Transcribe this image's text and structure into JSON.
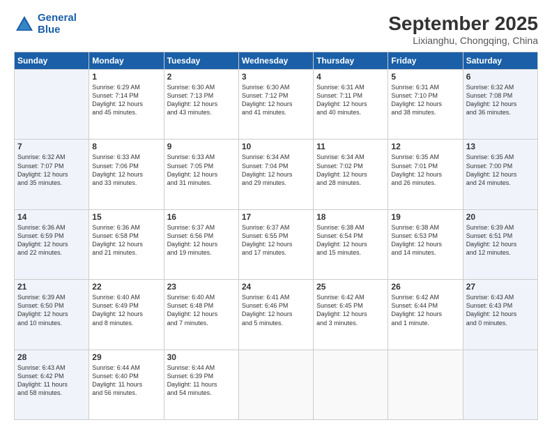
{
  "header": {
    "logo_line1": "General",
    "logo_line2": "Blue",
    "month": "September 2025",
    "location": "Lixianghu, Chongqing, China"
  },
  "weekdays": [
    "Sunday",
    "Monday",
    "Tuesday",
    "Wednesday",
    "Thursday",
    "Friday",
    "Saturday"
  ],
  "weeks": [
    [
      {
        "day": "",
        "info": ""
      },
      {
        "day": "1",
        "info": "Sunrise: 6:29 AM\nSunset: 7:14 PM\nDaylight: 12 hours\nand 45 minutes."
      },
      {
        "day": "2",
        "info": "Sunrise: 6:30 AM\nSunset: 7:13 PM\nDaylight: 12 hours\nand 43 minutes."
      },
      {
        "day": "3",
        "info": "Sunrise: 6:30 AM\nSunset: 7:12 PM\nDaylight: 12 hours\nand 41 minutes."
      },
      {
        "day": "4",
        "info": "Sunrise: 6:31 AM\nSunset: 7:11 PM\nDaylight: 12 hours\nand 40 minutes."
      },
      {
        "day": "5",
        "info": "Sunrise: 6:31 AM\nSunset: 7:10 PM\nDaylight: 12 hours\nand 38 minutes."
      },
      {
        "day": "6",
        "info": "Sunrise: 6:32 AM\nSunset: 7:08 PM\nDaylight: 12 hours\nand 36 minutes."
      }
    ],
    [
      {
        "day": "7",
        "info": "Sunrise: 6:32 AM\nSunset: 7:07 PM\nDaylight: 12 hours\nand 35 minutes."
      },
      {
        "day": "8",
        "info": "Sunrise: 6:33 AM\nSunset: 7:06 PM\nDaylight: 12 hours\nand 33 minutes."
      },
      {
        "day": "9",
        "info": "Sunrise: 6:33 AM\nSunset: 7:05 PM\nDaylight: 12 hours\nand 31 minutes."
      },
      {
        "day": "10",
        "info": "Sunrise: 6:34 AM\nSunset: 7:04 PM\nDaylight: 12 hours\nand 29 minutes."
      },
      {
        "day": "11",
        "info": "Sunrise: 6:34 AM\nSunset: 7:02 PM\nDaylight: 12 hours\nand 28 minutes."
      },
      {
        "day": "12",
        "info": "Sunrise: 6:35 AM\nSunset: 7:01 PM\nDaylight: 12 hours\nand 26 minutes."
      },
      {
        "day": "13",
        "info": "Sunrise: 6:35 AM\nSunset: 7:00 PM\nDaylight: 12 hours\nand 24 minutes."
      }
    ],
    [
      {
        "day": "14",
        "info": "Sunrise: 6:36 AM\nSunset: 6:59 PM\nDaylight: 12 hours\nand 22 minutes."
      },
      {
        "day": "15",
        "info": "Sunrise: 6:36 AM\nSunset: 6:58 PM\nDaylight: 12 hours\nand 21 minutes."
      },
      {
        "day": "16",
        "info": "Sunrise: 6:37 AM\nSunset: 6:56 PM\nDaylight: 12 hours\nand 19 minutes."
      },
      {
        "day": "17",
        "info": "Sunrise: 6:37 AM\nSunset: 6:55 PM\nDaylight: 12 hours\nand 17 minutes."
      },
      {
        "day": "18",
        "info": "Sunrise: 6:38 AM\nSunset: 6:54 PM\nDaylight: 12 hours\nand 15 minutes."
      },
      {
        "day": "19",
        "info": "Sunrise: 6:38 AM\nSunset: 6:53 PM\nDaylight: 12 hours\nand 14 minutes."
      },
      {
        "day": "20",
        "info": "Sunrise: 6:39 AM\nSunset: 6:51 PM\nDaylight: 12 hours\nand 12 minutes."
      }
    ],
    [
      {
        "day": "21",
        "info": "Sunrise: 6:39 AM\nSunset: 6:50 PM\nDaylight: 12 hours\nand 10 minutes."
      },
      {
        "day": "22",
        "info": "Sunrise: 6:40 AM\nSunset: 6:49 PM\nDaylight: 12 hours\nand 8 minutes."
      },
      {
        "day": "23",
        "info": "Sunrise: 6:40 AM\nSunset: 6:48 PM\nDaylight: 12 hours\nand 7 minutes."
      },
      {
        "day": "24",
        "info": "Sunrise: 6:41 AM\nSunset: 6:46 PM\nDaylight: 12 hours\nand 5 minutes."
      },
      {
        "day": "25",
        "info": "Sunrise: 6:42 AM\nSunset: 6:45 PM\nDaylight: 12 hours\nand 3 minutes."
      },
      {
        "day": "26",
        "info": "Sunrise: 6:42 AM\nSunset: 6:44 PM\nDaylight: 12 hours\nand 1 minute."
      },
      {
        "day": "27",
        "info": "Sunrise: 6:43 AM\nSunset: 6:43 PM\nDaylight: 12 hours\nand 0 minutes."
      }
    ],
    [
      {
        "day": "28",
        "info": "Sunrise: 6:43 AM\nSunset: 6:42 PM\nDaylight: 11 hours\nand 58 minutes."
      },
      {
        "day": "29",
        "info": "Sunrise: 6:44 AM\nSunset: 6:40 PM\nDaylight: 11 hours\nand 56 minutes."
      },
      {
        "day": "30",
        "info": "Sunrise: 6:44 AM\nSunset: 6:39 PM\nDaylight: 11 hours\nand 54 minutes."
      },
      {
        "day": "",
        "info": ""
      },
      {
        "day": "",
        "info": ""
      },
      {
        "day": "",
        "info": ""
      },
      {
        "day": "",
        "info": ""
      }
    ]
  ]
}
